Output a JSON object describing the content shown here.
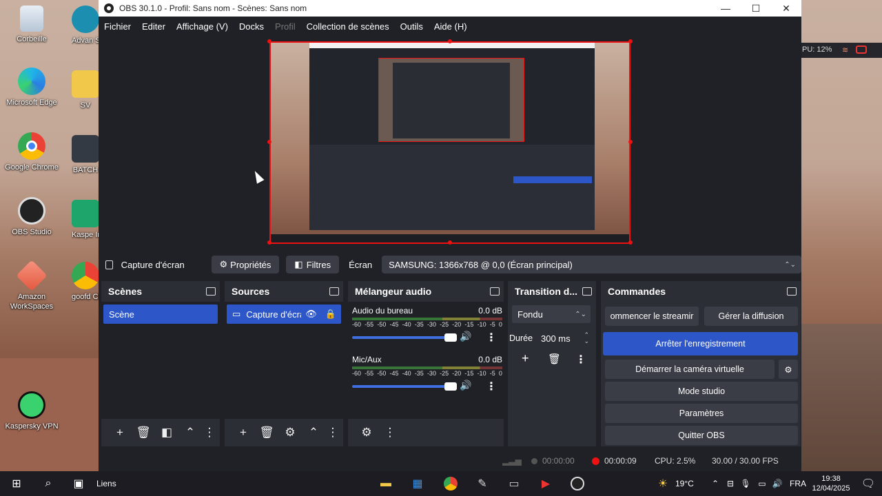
{
  "desktop": {
    "icons": [
      {
        "label": "Corbeille"
      },
      {
        "label": "Microsoft Edge"
      },
      {
        "label": "Google Chrome"
      },
      {
        "label": "OBS Studio"
      },
      {
        "label": "Amazon WorkSpaces"
      },
      {
        "label": "Kaspersky VPN"
      }
    ],
    "cut_icons": [
      {
        "label": "Advan System"
      },
      {
        "label": "SV"
      },
      {
        "label": "BATCH"
      },
      {
        "label": "Kaspe Internet S"
      },
      {
        "label": "goofd Chro"
      }
    ],
    "right_tray_text": "PU: 12%"
  },
  "window": {
    "title": "OBS 30.1.0 - Profil: Sans nom - Scènes: Sans nom",
    "controls": {
      "minimize": "—",
      "maximize": "☐",
      "close": "✕"
    }
  },
  "menu": [
    {
      "label": "Fichier",
      "enabled": true
    },
    {
      "label": "Editer",
      "enabled": true
    },
    {
      "label": "Affichage (V)",
      "enabled": true
    },
    {
      "label": "Docks",
      "enabled": true
    },
    {
      "label": "Profil",
      "enabled": false
    },
    {
      "label": "Collection de scènes",
      "enabled": true
    },
    {
      "label": "Outils",
      "enabled": true
    },
    {
      "label": "Aide (H)",
      "enabled": true
    }
  ],
  "sourcebar": {
    "source_name": "Capture d'écran",
    "properties": "Propriétés",
    "filters": "Filtres",
    "ecran_label": "Écran",
    "ecran_value": "SAMSUNG: 1366x768 @ 0,0 (Écran principal)"
  },
  "scenes": {
    "title": "Scènes",
    "items": [
      "Scène"
    ]
  },
  "sources": {
    "title": "Sources",
    "items": [
      "Capture d'écra"
    ]
  },
  "mixer": {
    "title": "Mélangeur audio",
    "scale": [
      "-60",
      "-55",
      "-50",
      "-45",
      "-40",
      "-35",
      "-30",
      "-25",
      "-20",
      "-15",
      "-10",
      "-5",
      "0"
    ],
    "channels": [
      {
        "name": "Audio du bureau",
        "db": "0.0 dB",
        "level": 0.95
      },
      {
        "name": "Mic/Aux",
        "db": "0.0 dB",
        "level": 0.95
      }
    ]
  },
  "transition": {
    "title": "Transition d...",
    "type": "Fondu",
    "duration_label": "Durée",
    "duration_value": "300 ms"
  },
  "commands": {
    "title": "Commandes",
    "start_streaming": "ommencer le streamir",
    "manage_broadcast": "Gérer la diffusion",
    "stop_recording": "Arrêter l'enregistrement",
    "virtual_camera": "Démarrer la caméra virtuelle",
    "studio_mode": "Mode studio",
    "settings": "Paramètres",
    "quit": "Quitter OBS"
  },
  "status": {
    "stream_time": "00:00:00",
    "rec_time": "00:00:09",
    "cpu": "CPU: 2.5%",
    "fps": "30.00 / 30.00 FPS"
  },
  "taskbar": {
    "links": "Liens",
    "weather": "19°C",
    "lang": "FRA",
    "time": "19:38",
    "date": "12/04/2025"
  },
  "colors": {
    "accent": "#2d56c9",
    "record": "#e11111",
    "bg": "#1f2127",
    "panel": "#2b2e35"
  }
}
